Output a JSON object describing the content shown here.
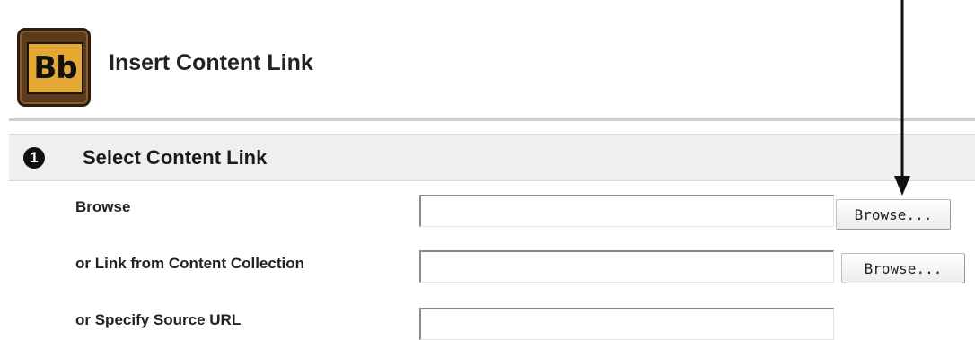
{
  "header": {
    "logo_text": "Bb",
    "title": "Insert Content Link"
  },
  "section": {
    "step_number": "1",
    "title": "Select Content Link"
  },
  "form": {
    "browse_label": "Browse",
    "browse_button": "Browse...",
    "collection_label": "or Link from Content Collection",
    "collection_button": "Browse...",
    "url_label": "or Specify Source URL",
    "browse_value": "",
    "collection_value": "",
    "url_value": ""
  },
  "colors": {
    "logo_board": "#e3a733",
    "logo_frame": "#5c3a1c",
    "section_bg": "#efefef"
  },
  "icons": {
    "logo": "blackboard-logo-icon",
    "step": "step-number-icon",
    "annotation": "down-arrow-icon"
  }
}
